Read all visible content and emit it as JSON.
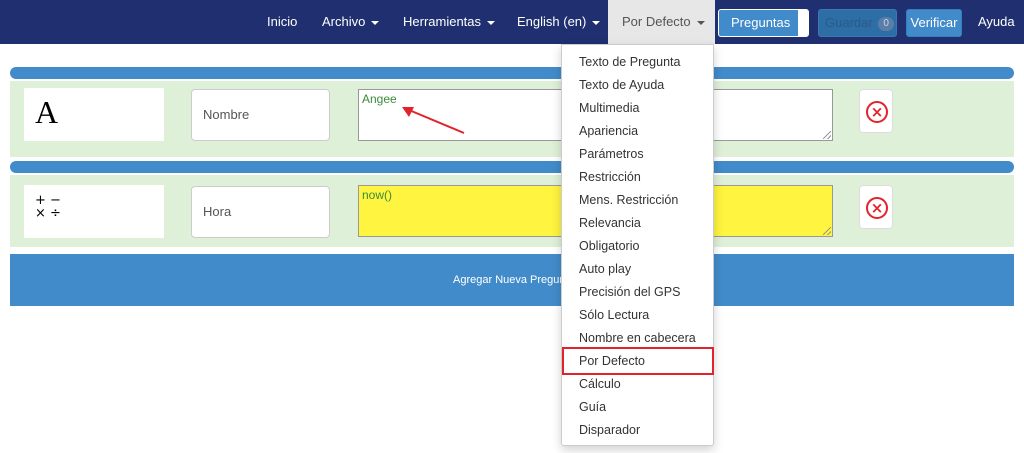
{
  "navbar": {
    "inicio": "Inicio",
    "archivo": "Archivo",
    "herramientas": "Herramientas",
    "language": "English (en)",
    "por_defecto": "Por Defecto",
    "preguntas": "Preguntas",
    "guardar": "Guardar",
    "guardar_count": "0",
    "verificar": "Verificar",
    "ayuda": "Ayuda"
  },
  "questions": [
    {
      "type_icon": "A",
      "type_icon_name": "text-type-icon",
      "name": "Nombre",
      "default_value": "Angee",
      "field_color": "#ffffff"
    },
    {
      "type_icon": "+ −\n× ÷",
      "type_icon_name": "calculation-type-icon",
      "name": "Hora",
      "default_value": "now()",
      "field_color": "#fff43f"
    }
  ],
  "add_question_label": "Agregar Nueva Pregunta",
  "dropdown": {
    "items": [
      "Texto de Pregunta",
      "Texto de Ayuda",
      "Multimedia",
      "Apariencia",
      "Parámetros",
      "Restricción",
      "Mens. Restricción",
      "Relevancia",
      "Obligatorio",
      "Auto play",
      "Precisión del GPS",
      "Sólo Lectura",
      "Nombre en cabecera",
      "Por Defecto",
      "Cálculo",
      "Guía",
      "Disparador"
    ],
    "highlighted": "Por Defecto"
  },
  "colors": {
    "navbar": "#1f2f6f",
    "accent_blue": "#428bca",
    "row_green": "#dff0d8",
    "delete_red": "#e3222b",
    "highlight_red": "#e3222b",
    "default_text_green": "#3c8b3c"
  }
}
